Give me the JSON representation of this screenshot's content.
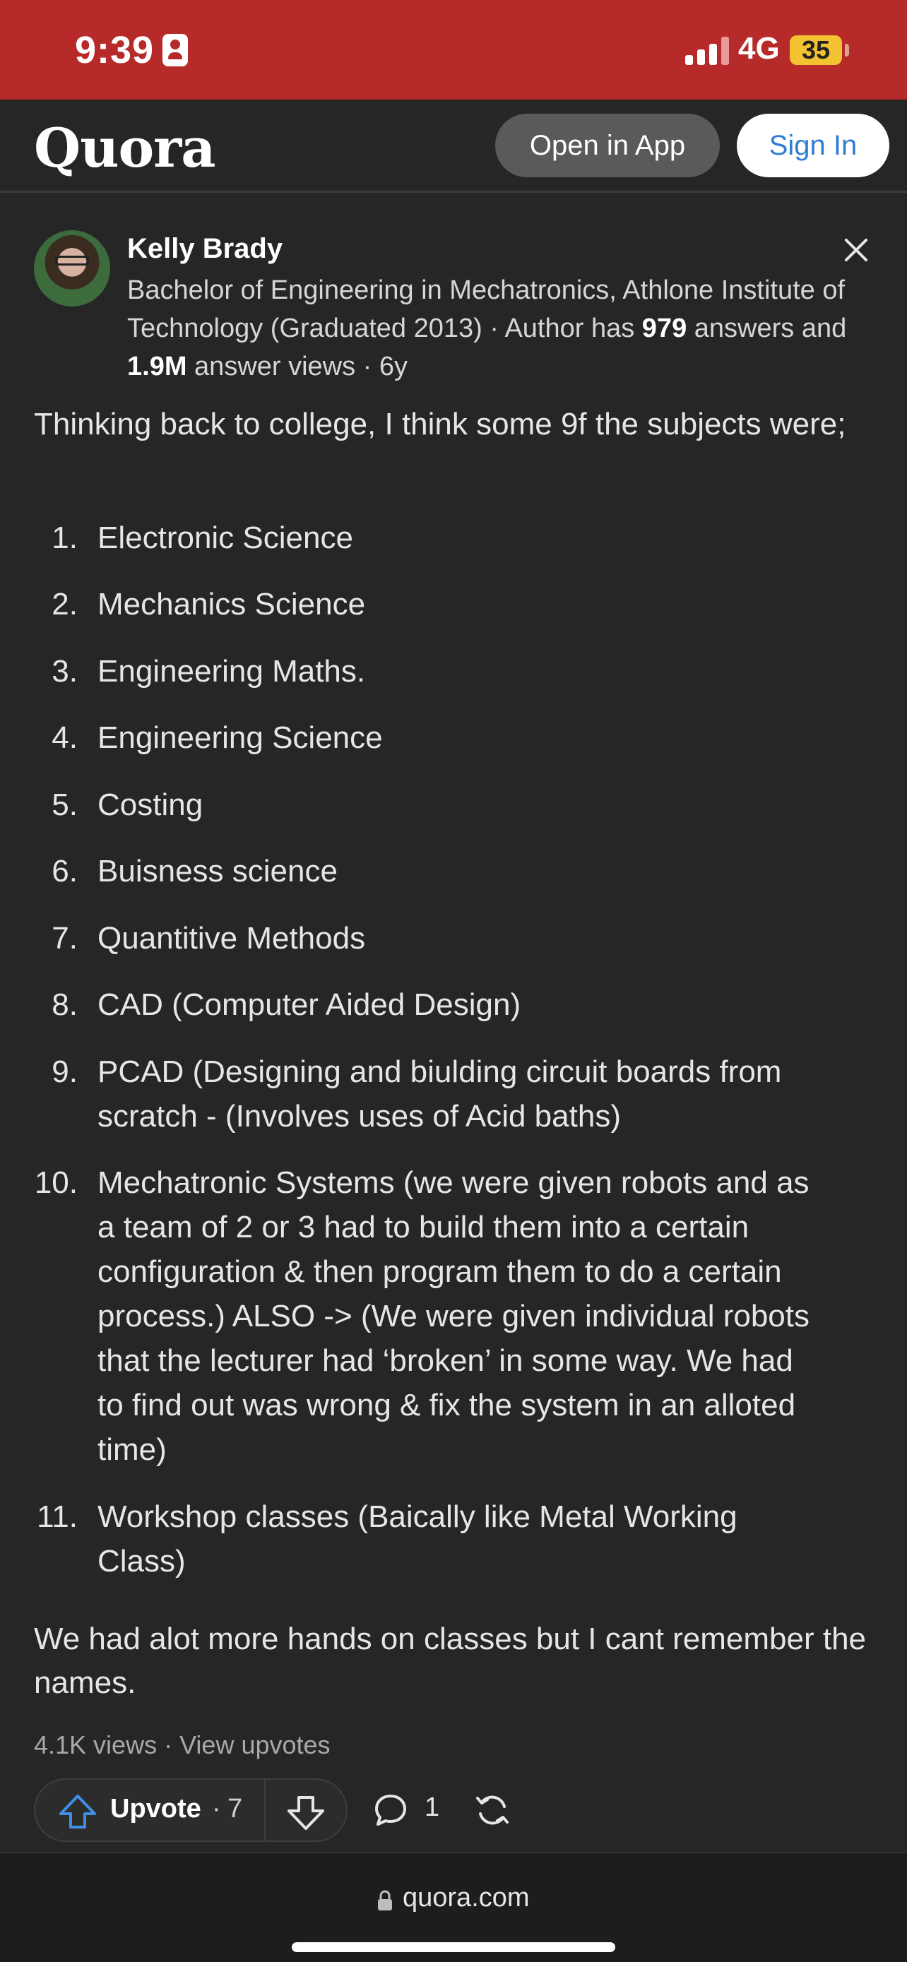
{
  "status_bar": {
    "time": "9:39",
    "network": "4G",
    "battery": "35"
  },
  "header": {
    "logo": "Quora",
    "open_in_app": "Open in App",
    "sign_in": "Sign In"
  },
  "answer": {
    "author_name": "Kelly Brady",
    "credential_prefix": "Bachelor of Engineering in Mechatronics, Athlone Institute of Technology (Graduated 2013) · Author has",
    "answers_count": "979",
    "answers_mid": "answers and",
    "answer_views": "1.9M",
    "answers_suffix": "answer views · 6y",
    "intro": "Thinking back to college, I think some 9f the subjects were;",
    "items": [
      {
        "num": "1.",
        "text": "Electronic Science"
      },
      {
        "num": "2.",
        "text": "Mechanics Science"
      },
      {
        "num": "3.",
        "text": "Engineering Maths."
      },
      {
        "num": "4.",
        "text": "Engineering Science"
      },
      {
        "num": "5.",
        "text": "Costing"
      },
      {
        "num": "6.",
        "text": "Buisness science"
      },
      {
        "num": "7.",
        "text": "Quantitive Methods"
      },
      {
        "num": "8.",
        "text": "CAD (Computer Aided Design)"
      },
      {
        "num": "9.",
        "text": "PCAD (Designing and biulding circuit boards from scratch - (Involves uses of Acid baths)"
      },
      {
        "num": "10.",
        "text": "Mechatronic Systems (we were given robots and as a team of 2 or 3 had to build them into a certain configuration & then program them to do a certain process.) ALSO -> (We were given individual robots that the lecturer had ‘broken’ in some way. We had to find out was wrong & fix the system in an alloted time)"
      },
      {
        "num": "11.",
        "text": "Workshop classes (Baically like Metal Working Class)"
      }
    ],
    "outro": "We had alot more hands on classes but I cant remember the names.",
    "views_text": "4.1K views · View upvotes",
    "upvote_label": "Upvote",
    "upvote_sep": "·",
    "upvote_count": "7",
    "comment_count": "1"
  },
  "bottom_bar": {
    "url": "quora.com"
  },
  "colors": {
    "status_bar": "#b72a2a",
    "background": "#262626",
    "sign_in_text": "#2e7ed6",
    "upvote_icon": "#3f8fe6",
    "battery": "#f2c230"
  },
  "icons": [
    "id-badge-icon",
    "signal-icon",
    "close-icon",
    "upvote-arrow-icon",
    "downvote-arrow-icon",
    "comment-icon",
    "share-icon",
    "lock-icon"
  ]
}
